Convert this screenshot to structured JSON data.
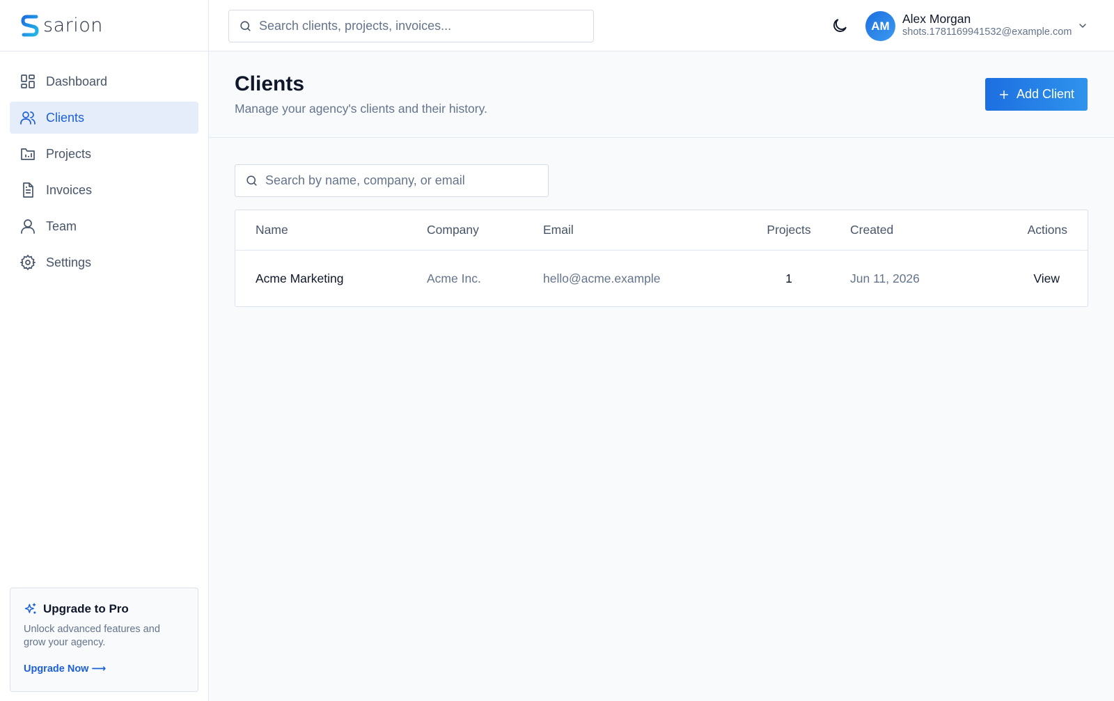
{
  "brand": {
    "name": "sarion",
    "accent": "#1d6fe0"
  },
  "sidebar": {
    "items": [
      {
        "label": "Dashboard",
        "icon": "dashboard-icon"
      },
      {
        "label": "Clients",
        "icon": "users-icon",
        "active": true
      },
      {
        "label": "Projects",
        "icon": "folder-chart-icon"
      },
      {
        "label": "Invoices",
        "icon": "document-icon"
      },
      {
        "label": "Team",
        "icon": "user-icon"
      },
      {
        "label": "Settings",
        "icon": "gear-icon"
      }
    ],
    "upgrade": {
      "title": "Upgrade to Pro",
      "text": "Unlock advanced features and grow your agency.",
      "link": "Upgrade Now ⟶"
    }
  },
  "topbar": {
    "search_placeholder": "Search clients, projects, invoices...",
    "user": {
      "initials": "AM",
      "name": "Alex Morgan",
      "email": "shots.1781169941532@example.com"
    }
  },
  "header": {
    "title": "Clients",
    "subtitle": "Manage your agency's clients and their history.",
    "add_label": "Add Client"
  },
  "clients": {
    "search_placeholder": "Search by name, company, or email",
    "columns": {
      "name": "Name",
      "company": "Company",
      "email": "Email",
      "projects": "Projects",
      "created": "Created",
      "actions": "Actions"
    },
    "rows": [
      {
        "name": "Acme Marketing",
        "company": "Acme Inc.",
        "email": "hello@acme.example",
        "projects": "1",
        "created": "Jun 11, 2026",
        "action": "View"
      }
    ]
  }
}
